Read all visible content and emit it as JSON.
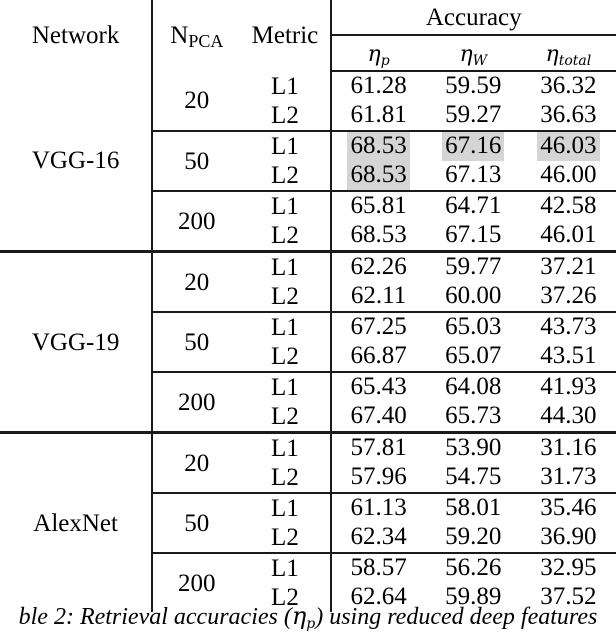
{
  "table": {
    "headers": {
      "network": "Network",
      "npca": "N",
      "npca_sub": "PCA",
      "metric": "Metric",
      "accuracy": "Accuracy",
      "eta_p_sym": "η",
      "eta_p_sub": "p",
      "eta_w_sym": "η",
      "eta_w_sub": "W",
      "eta_total_sym": "η",
      "eta_total_sub": "total"
    },
    "highlight_color": "#d5d5d5",
    "rule_color": "#1a1a1a",
    "blocks": [
      {
        "network": "VGG-16",
        "groups": [
          {
            "npca": "20",
            "rows": [
              {
                "metric": "L1",
                "eta_p": "61.28",
                "eta_w": "59.59",
                "eta_total": "36.32",
                "hl_p": false,
                "hl_w": false,
                "hl_t": false
              },
              {
                "metric": "L2",
                "eta_p": "61.81",
                "eta_w": "59.27",
                "eta_total": "36.63",
                "hl_p": false,
                "hl_w": false,
                "hl_t": false
              }
            ]
          },
          {
            "npca": "50",
            "rows": [
              {
                "metric": "L1",
                "eta_p": "68.53",
                "eta_w": "67.16",
                "eta_total": "46.03",
                "hl_p": true,
                "hl_w": true,
                "hl_t": true
              },
              {
                "metric": "L2",
                "eta_p": "68.53",
                "eta_w": "67.13",
                "eta_total": "46.00",
                "hl_p": true,
                "hl_w": false,
                "hl_t": false
              }
            ]
          },
          {
            "npca": "200",
            "rows": [
              {
                "metric": "L1",
                "eta_p": "65.81",
                "eta_w": "64.71",
                "eta_total": "42.58",
                "hl_p": false,
                "hl_w": false,
                "hl_t": false
              },
              {
                "metric": "L2",
                "eta_p": "68.53",
                "eta_w": "67.15",
                "eta_total": "46.01",
                "hl_p": false,
                "hl_w": false,
                "hl_t": false
              }
            ]
          }
        ]
      },
      {
        "network": "VGG-19",
        "groups": [
          {
            "npca": "20",
            "rows": [
              {
                "metric": "L1",
                "eta_p": "62.26",
                "eta_w": "59.77",
                "eta_total": "37.21",
                "hl_p": false,
                "hl_w": false,
                "hl_t": false
              },
              {
                "metric": "L2",
                "eta_p": "62.11",
                "eta_w": "60.00",
                "eta_total": "37.26",
                "hl_p": false,
                "hl_w": false,
                "hl_t": false
              }
            ]
          },
          {
            "npca": "50",
            "rows": [
              {
                "metric": "L1",
                "eta_p": "67.25",
                "eta_w": "65.03",
                "eta_total": "43.73",
                "hl_p": false,
                "hl_w": false,
                "hl_t": false
              },
              {
                "metric": "L2",
                "eta_p": "66.87",
                "eta_w": "65.07",
                "eta_total": "43.51",
                "hl_p": false,
                "hl_w": false,
                "hl_t": false
              }
            ]
          },
          {
            "npca": "200",
            "rows": [
              {
                "metric": "L1",
                "eta_p": "65.43",
                "eta_w": "64.08",
                "eta_total": "41.93",
                "hl_p": false,
                "hl_w": false,
                "hl_t": false
              },
              {
                "metric": "L2",
                "eta_p": "67.40",
                "eta_w": "65.73",
                "eta_total": "44.30",
                "hl_p": false,
                "hl_w": false,
                "hl_t": false
              }
            ]
          }
        ]
      },
      {
        "network": "AlexNet",
        "groups": [
          {
            "npca": "20",
            "rows": [
              {
                "metric": "L1",
                "eta_p": "57.81",
                "eta_w": "53.90",
                "eta_total": "31.16",
                "hl_p": false,
                "hl_w": false,
                "hl_t": false
              },
              {
                "metric": "L2",
                "eta_p": "57.96",
                "eta_w": "54.75",
                "eta_total": "31.73",
                "hl_p": false,
                "hl_w": false,
                "hl_t": false
              }
            ]
          },
          {
            "npca": "50",
            "rows": [
              {
                "metric": "L1",
                "eta_p": "61.13",
                "eta_w": "58.01",
                "eta_total": "35.46",
                "hl_p": false,
                "hl_w": false,
                "hl_t": false
              },
              {
                "metric": "L2",
                "eta_p": "62.34",
                "eta_w": "59.20",
                "eta_total": "36.90",
                "hl_p": false,
                "hl_w": false,
                "hl_t": false
              }
            ]
          },
          {
            "npca": "200",
            "rows": [
              {
                "metric": "L1",
                "eta_p": "58.57",
                "eta_w": "56.26",
                "eta_total": "32.95",
                "hl_p": false,
                "hl_w": false,
                "hl_t": false
              },
              {
                "metric": "L2",
                "eta_p": "62.64",
                "eta_w": "59.89",
                "eta_total": "37.52",
                "hl_p": false,
                "hl_w": false,
                "hl_t": false
              }
            ]
          }
        ]
      }
    ]
  },
  "caption": {
    "before": "ble 2: Retrieval accuracies (",
    "eta_sym": "η",
    "eta_sub": "p",
    "after": ") using reduced deep features"
  }
}
